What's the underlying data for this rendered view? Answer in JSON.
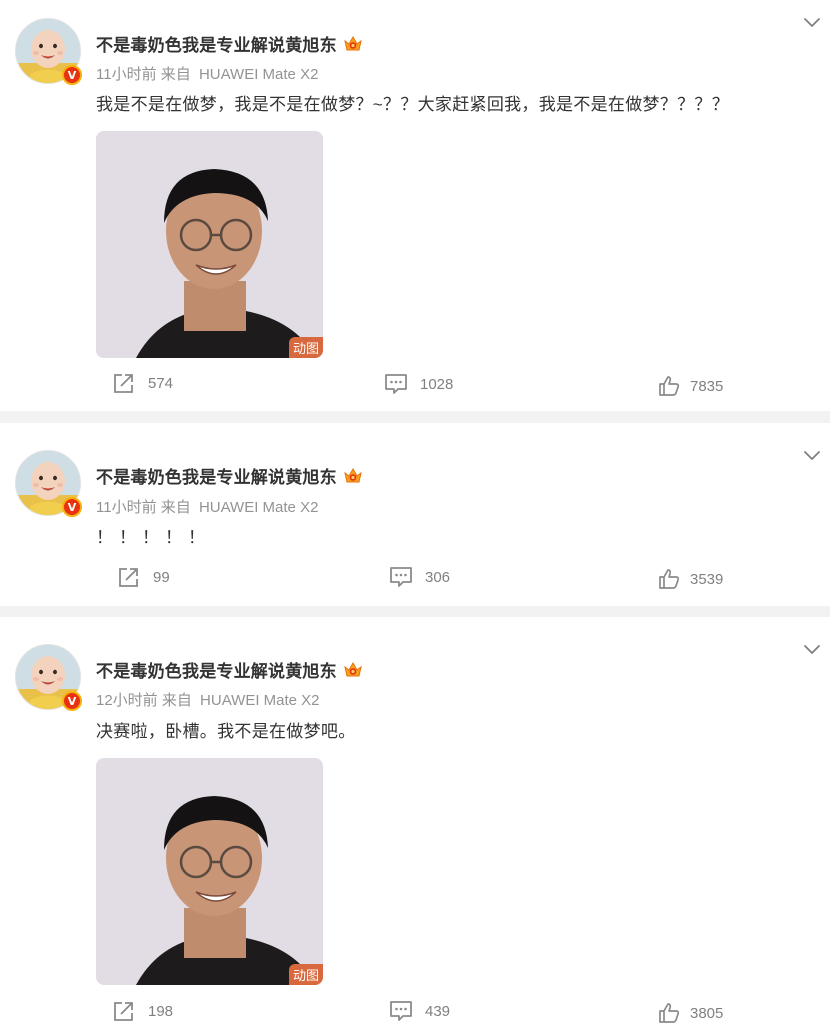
{
  "posts": [
    {
      "author": "不是毒奶色我是专业解说黄旭东",
      "time": "11小时前",
      "source_prefix": "来自",
      "source_app": "HUAWEI Mate X2",
      "content": "我是不是在做梦，我是不是在做梦？~？？大家赶紧回我，我是不是在做梦？？？？",
      "media_tag": "动图",
      "reposts": "574",
      "comments": "1028",
      "likes": "7835"
    },
    {
      "author": "不是毒奶色我是专业解说黄旭东",
      "time": "11小时前",
      "source_prefix": "来自",
      "source_app": "HUAWEI Mate X2",
      "content": "！！！！！",
      "reposts": "99",
      "comments": "306",
      "likes": "3539"
    },
    {
      "author": "不是毒奶色我是专业解说黄旭东",
      "time": "12小时前",
      "source_prefix": "来自",
      "source_app": "HUAWEI Mate X2",
      "content": "决赛啦，卧槽。我不是在做梦吧。",
      "media_tag": "动图",
      "reposts": "198",
      "comments": "439",
      "likes": "3805"
    }
  ],
  "icons": {
    "verified": "verified-v-badge",
    "vip": "vip-crown-icon",
    "menu": "chevron-down-icon",
    "repost": "repost-icon",
    "comment": "comment-icon",
    "like": "thumbs-up-icon"
  },
  "badge_letter": "V",
  "colors": {
    "text": "#333333",
    "meta": "#939393",
    "verified": "#e8320f",
    "gif_tag": "#d8683e",
    "divider": "#f2f2f2"
  }
}
